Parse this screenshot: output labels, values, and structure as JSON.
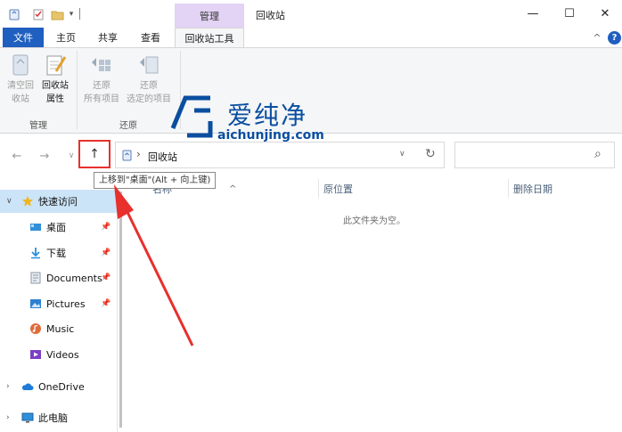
{
  "window": {
    "title": "回收站",
    "context_tab_group": "管理",
    "minimize_glyph": "—",
    "maximize_glyph": "☐",
    "close_glyph": "✕"
  },
  "ribbon_tabs": {
    "file": "文件",
    "home": "主页",
    "share": "共享",
    "view": "查看",
    "tools": "回收站工具",
    "collapse": "^",
    "help": "?"
  },
  "ribbon": {
    "empty_bin_line1": "清空回",
    "empty_bin_line2": "收站",
    "properties_line1": "回收站",
    "properties_line2": "属性",
    "manage_group": "管理",
    "restore_all_line1": "还原",
    "restore_all_line2": "所有项目",
    "restore_selected_line1": "还原",
    "restore_selected_line2": "选定的项目",
    "restore_group": "还原"
  },
  "watermark": {
    "text": "爱纯净",
    "url": "aichunjing.com"
  },
  "address": {
    "back_glyph": "←",
    "forward_glyph": "→",
    "recent_glyph": "∨",
    "up_glyph": "↑",
    "separator": "›",
    "location": "回收站",
    "dropdown_glyph": "∨",
    "refresh_glyph": "↻",
    "search_glyph": "⌕",
    "tooltip": "上移到\"桌面\"(Alt + 向上键)"
  },
  "nav": {
    "quick_access": "快速访问",
    "items": [
      {
        "label": "桌面",
        "pinned": true
      },
      {
        "label": "下载",
        "pinned": true
      },
      {
        "label": "Documents",
        "pinned": true
      },
      {
        "label": "Pictures",
        "pinned": true
      },
      {
        "label": "Music",
        "pinned": false
      },
      {
        "label": "Videos",
        "pinned": false
      }
    ],
    "onedrive": "OneDrive",
    "this_pc": "此电脑"
  },
  "content": {
    "col_name": "名称",
    "col_location": "原位置",
    "col_deleted": "删除日期",
    "sort_glyph": "^",
    "empty_message": "此文件夹为空。"
  },
  "colors": {
    "accent": "#1f5fbf",
    "context_tab": "#e3d3f4",
    "highlight_red": "#e8302c",
    "selection": "#cce4f7",
    "watermark": "#0a4ea0"
  }
}
